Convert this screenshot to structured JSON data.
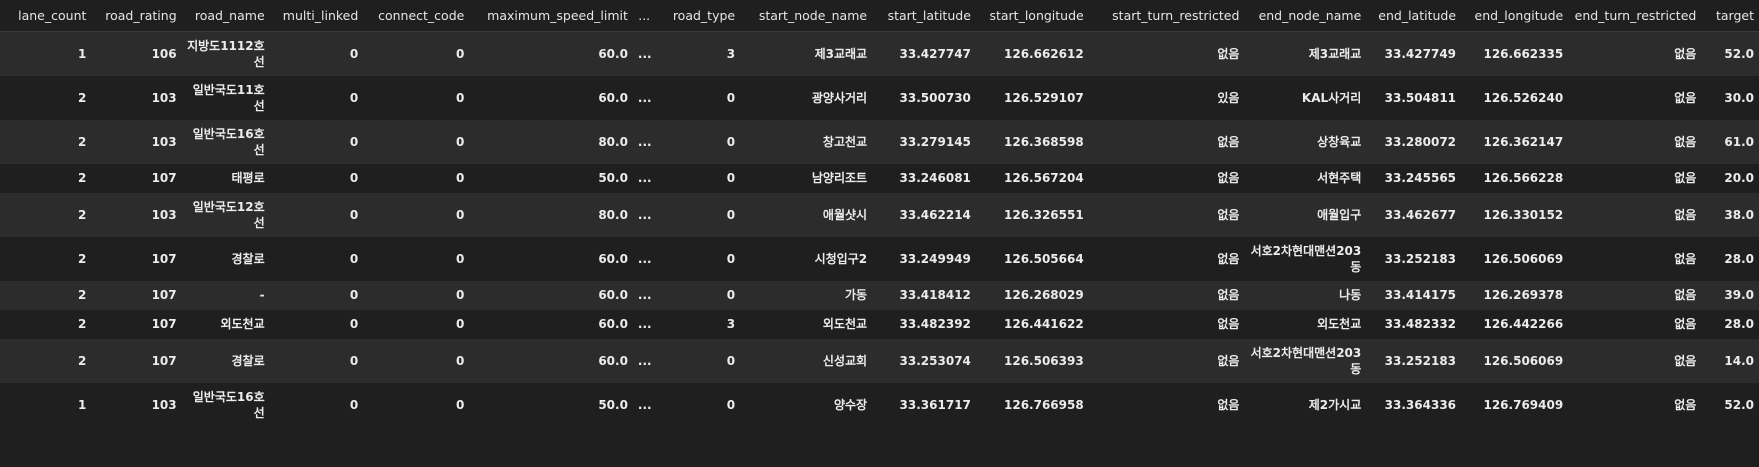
{
  "columns": [
    "lane_count",
    "road_rating",
    "road_name",
    "multi_linked",
    "connect_code",
    "maximum_speed_limit",
    "...",
    "road_type",
    "start_node_name",
    "start_latitude",
    "start_longitude",
    "start_turn_restricted",
    "end_node_name",
    "end_latitude",
    "end_longitude",
    "end_turn_restricted",
    "target"
  ],
  "rows": [
    [
      "1",
      "106",
      "지방도1112호선",
      "0",
      "0",
      "60.0",
      "...",
      "3",
      "제3교래교",
      "33.427747",
      "126.662612",
      "없음",
      "제3교래교",
      "33.427749",
      "126.662335",
      "없음",
      "52.0"
    ],
    [
      "2",
      "103",
      "일반국도11호선",
      "0",
      "0",
      "60.0",
      "...",
      "0",
      "광양사거리",
      "33.500730",
      "126.529107",
      "있음",
      "KAL사거리",
      "33.504811",
      "126.526240",
      "없음",
      "30.0"
    ],
    [
      "2",
      "103",
      "일반국도16호선",
      "0",
      "0",
      "80.0",
      "...",
      "0",
      "창고천교",
      "33.279145",
      "126.368598",
      "없음",
      "상창육교",
      "33.280072",
      "126.362147",
      "없음",
      "61.0"
    ],
    [
      "2",
      "107",
      "태평로",
      "0",
      "0",
      "50.0",
      "...",
      "0",
      "남양리조트",
      "33.246081",
      "126.567204",
      "없음",
      "서현주택",
      "33.245565",
      "126.566228",
      "없음",
      "20.0"
    ],
    [
      "2",
      "103",
      "일반국도12호선",
      "0",
      "0",
      "80.0",
      "...",
      "0",
      "애월샷시",
      "33.462214",
      "126.326551",
      "없음",
      "애월입구",
      "33.462677",
      "126.330152",
      "없음",
      "38.0"
    ],
    [
      "2",
      "107",
      "경찰로",
      "0",
      "0",
      "60.0",
      "...",
      "0",
      "시청입구2",
      "33.249949",
      "126.505664",
      "없음",
      "서호2차현대맨션203동",
      "33.252183",
      "126.506069",
      "없음",
      "28.0"
    ],
    [
      "2",
      "107",
      "-",
      "0",
      "0",
      "60.0",
      "...",
      "0",
      "가동",
      "33.418412",
      "126.268029",
      "없음",
      "나동",
      "33.414175",
      "126.269378",
      "없음",
      "39.0"
    ],
    [
      "2",
      "107",
      "외도천교",
      "0",
      "0",
      "60.0",
      "...",
      "3",
      "외도천교",
      "33.482392",
      "126.441622",
      "없음",
      "외도천교",
      "33.482332",
      "126.442266",
      "없음",
      "28.0"
    ],
    [
      "2",
      "107",
      "경찰로",
      "0",
      "0",
      "60.0",
      "...",
      "0",
      "신성교회",
      "33.253074",
      "126.506393",
      "없음",
      "서호2차현대맨션203동",
      "33.252183",
      "126.506069",
      "없음",
      "14.0"
    ],
    [
      "1",
      "103",
      "일반국도16호선",
      "0",
      "0",
      "50.0",
      "...",
      "0",
      "양수장",
      "33.361717",
      "126.766958",
      "없음",
      "제2가시교",
      "33.364336",
      "126.769409",
      "없음",
      "52.0"
    ]
  ],
  "short_rows": [
    3,
    6,
    7
  ]
}
